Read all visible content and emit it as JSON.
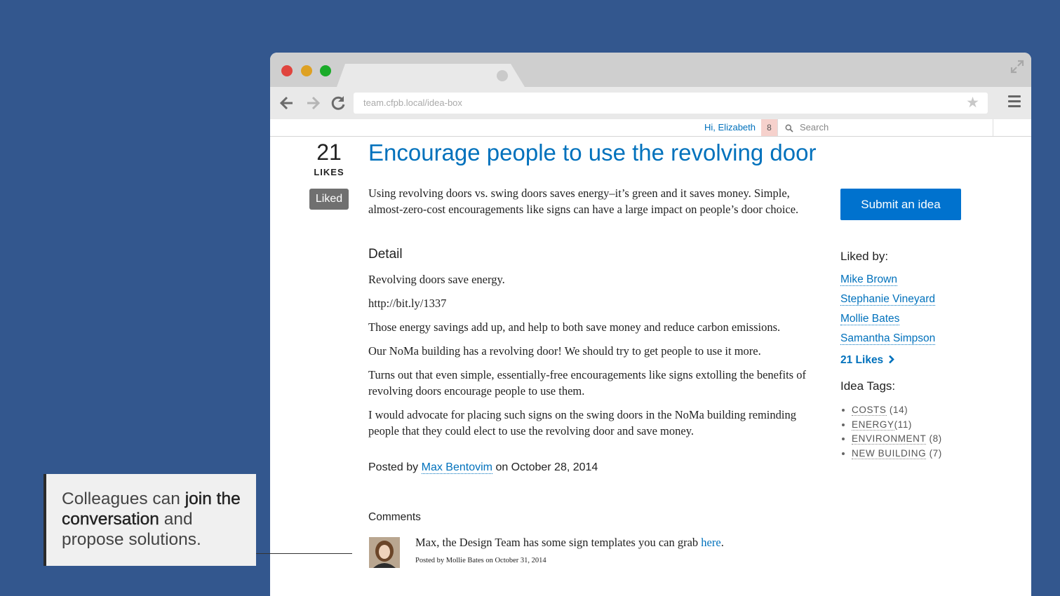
{
  "browser": {
    "url": "team.cfpb.local/idea-box"
  },
  "site": {
    "greeting": "Hi, Elizabeth",
    "notifications": "8",
    "search_placeholder": "Search"
  },
  "idea": {
    "likes_count": "21",
    "likes_label": "LIKES",
    "liked_label": "Liked",
    "title": "Encourage people to use the revolving door",
    "summary": "Using revolving doors vs. swing doors saves energy–it’s green and it saves money. Simple, almost-zero-cost encouragements like signs can have a large impact on people’s door choice.",
    "detail_heading": "Detail",
    "detail_paragraphs": [
      "Revolving doors save energy.",
      "http://bit.ly/1337",
      "Those energy savings add up, and help to both save money and reduce carbon emissions.",
      "Our NoMa building has a revolving door! We should try to get people to use it more.",
      "Turns out that even simple, essentially-free encouragements like signs extolling the benefits of revolving doors encourage people to use them.",
      "I would advocate for placing such signs on the swing doors in the NoMa building reminding people that they could elect to use the revolving door and save money."
    ],
    "posted_prefix": "Posted by",
    "author": "Max Bentovim",
    "posted_suffix": "on October 28, 2014"
  },
  "comments": {
    "heading": "Comments",
    "items": [
      {
        "text": "Max, the Design Team has some sign templates you can grab",
        "link": "here",
        "trail": ".",
        "meta": "Posted by Mollie Bates on October 31, 2014"
      }
    ]
  },
  "sidebar": {
    "submit_label": "Submit an idea",
    "liked_by_heading": "Liked by:",
    "likers": [
      "Mike Brown",
      "Stephanie Vineyard",
      "Mollie Bates",
      "Samantha Simpson"
    ],
    "likes_link": "21 Likes",
    "tags_heading": "Idea Tags:",
    "tags": [
      {
        "name": "COSTS",
        "count": " (14)"
      },
      {
        "name": "ENERGY",
        "count": "(11)"
      },
      {
        "name": "ENVIRONMENT",
        "count": " (8)"
      },
      {
        "name": "NEW BUILDING",
        "count": " (7)"
      }
    ]
  },
  "callout": {
    "part1": "Colleagues can ",
    "bold1": "join the conversation",
    "part2": " and propose solutions."
  },
  "colors": {
    "background": "#33578e",
    "link": "#0071bc",
    "primary_button": "#0072ce",
    "liked_button": "#707070"
  }
}
